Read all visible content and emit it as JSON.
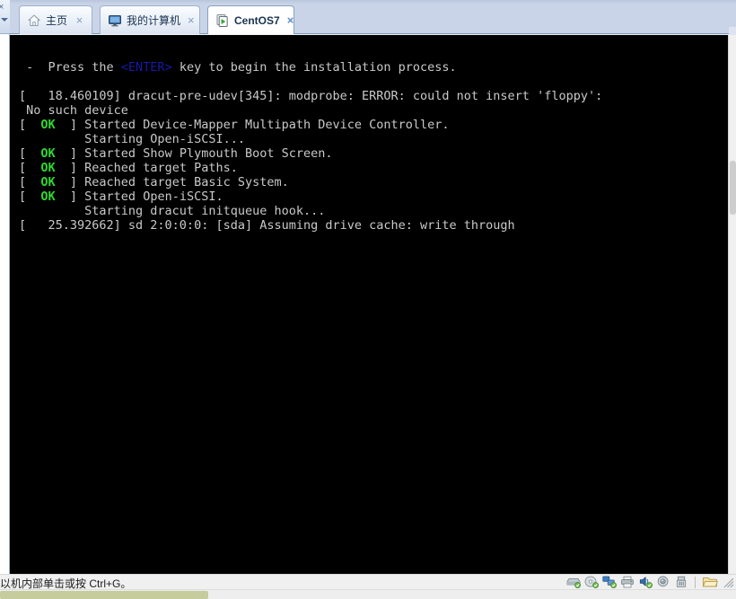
{
  "window": {
    "tab_strip_bg": "#c9d4e8",
    "console_bg": "#000000",
    "accent": "#2fd82f"
  },
  "tabs": [
    {
      "id": "home",
      "label": "主页",
      "icon": "home-icon",
      "close_label": "×",
      "active": false
    },
    {
      "id": "mycomp",
      "label": "我的计算机",
      "icon": "my-computer-icon",
      "close_label": "×",
      "active": false
    },
    {
      "id": "centos7",
      "label": "CentOS7",
      "icon": "virtual-machine-icon",
      "close_label": "×",
      "active": true
    }
  ],
  "left_panel": {
    "close_label": "×",
    "dropdown_label": "▾"
  },
  "console": {
    "lines": [
      {
        "id": "l1",
        "segments": [
          {
            "text": " -  Press the "
          },
          {
            "text": "<ENTER>",
            "style": "key"
          },
          {
            "text": " key to begin the installation process."
          }
        ]
      },
      {
        "id": "l2",
        "segments": [
          {
            "text": ""
          }
        ]
      },
      {
        "id": "l3",
        "segments": [
          {
            "text": "[   18.460109] dracut-pre-udev[345]: modprobe: ERROR: could not insert 'floppy':"
          }
        ]
      },
      {
        "id": "l4",
        "segments": [
          {
            "text": " No such device"
          }
        ]
      },
      {
        "id": "l5",
        "segments": [
          {
            "text": "[  "
          },
          {
            "text": "OK",
            "style": "ok"
          },
          {
            "text": "  ] Started Device-Mapper Multipath Device Controller."
          }
        ]
      },
      {
        "id": "l6",
        "segments": [
          {
            "text": "         Starting Open-iSCSI..."
          }
        ]
      },
      {
        "id": "l7",
        "segments": [
          {
            "text": "[  "
          },
          {
            "text": "OK",
            "style": "ok"
          },
          {
            "text": "  ] Started Show Plymouth Boot Screen."
          }
        ]
      },
      {
        "id": "l8",
        "segments": [
          {
            "text": "[  "
          },
          {
            "text": "OK",
            "style": "ok"
          },
          {
            "text": "  ] Reached target Paths."
          }
        ]
      },
      {
        "id": "l9",
        "segments": [
          {
            "text": "[  "
          },
          {
            "text": "OK",
            "style": "ok"
          },
          {
            "text": "  ] Reached target Basic System."
          }
        ]
      },
      {
        "id": "l10",
        "segments": [
          {
            "text": "[  "
          },
          {
            "text": "OK",
            "style": "ok"
          },
          {
            "text": "  ] Started Open-iSCSI."
          }
        ]
      },
      {
        "id": "l11",
        "segments": [
          {
            "text": "         Starting dracut initqueue hook..."
          }
        ]
      },
      {
        "id": "l12",
        "segments": [
          {
            "text": "[   25.392662] sd 2:0:0:0: [sda] Assuming drive cache: write through"
          }
        ]
      },
      {
        "id": "l13",
        "segments": [
          {
            "text": "",
            "style": "cursor"
          }
        ]
      }
    ]
  },
  "statusbar": {
    "hint": "以机内部单击或按 Ctrl+G。",
    "icons": [
      {
        "id": "hard-disk",
        "name": "hard-disk-icon"
      },
      {
        "id": "cd-dvd",
        "name": "cd-dvd-icon"
      },
      {
        "id": "network",
        "name": "network-adapter-icon"
      },
      {
        "id": "printer",
        "name": "printer-icon"
      },
      {
        "id": "sound",
        "name": "sound-card-icon"
      },
      {
        "id": "camera",
        "name": "webcam-icon"
      },
      {
        "id": "usb",
        "name": "usb-controller-icon"
      },
      {
        "id": "separator",
        "name": "status-separator"
      },
      {
        "id": "folder",
        "name": "shared-folder-icon"
      }
    ],
    "resize_grip": "resize-grip-icon"
  },
  "scrollbars": {
    "vertical_thumb_color": "#cdcdcd",
    "horizontal_thumb_color": "#c6cc9c"
  }
}
